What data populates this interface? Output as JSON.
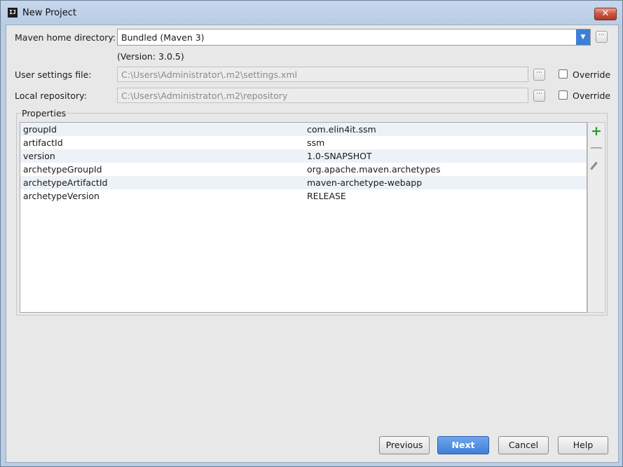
{
  "window": {
    "app_icon": "IJ",
    "title": "New Project",
    "close_glyph": "✕"
  },
  "form": {
    "maven_home_label": "Maven home directory:",
    "maven_home_value": "Bundled (Maven 3)",
    "version_text": "(Version: 3.0.5)",
    "user_settings_label": "User settings file:",
    "user_settings_value": "C:\\Users\\Administrator\\.m2\\settings.xml",
    "local_repo_label": "Local repository:",
    "local_repo_value": "C:\\Users\\Administrator\\.m2\\repository",
    "override_label": "Override",
    "browse_glyph": "···"
  },
  "properties": {
    "title": "Properties",
    "rows": [
      {
        "key": "groupId",
        "value": "com.elin4it.ssm"
      },
      {
        "key": "artifactId",
        "value": "ssm"
      },
      {
        "key": "version",
        "value": "1.0-SNAPSHOT"
      },
      {
        "key": "archetypeGroupId",
        "value": "org.apache.maven.archetypes"
      },
      {
        "key": "archetypeArtifactId",
        "value": "maven-archetype-webapp"
      },
      {
        "key": "archetypeVersion",
        "value": "RELEASE"
      }
    ],
    "add_glyph": "+",
    "remove_glyph": "—"
  },
  "buttons": {
    "previous": "Previous",
    "next": "Next",
    "cancel": "Cancel",
    "help": "Help"
  },
  "colors": {
    "primary_button": "#3f7fd8",
    "combo_arrow": "#3c7fd6",
    "add_icon": "#2e9a2e"
  }
}
